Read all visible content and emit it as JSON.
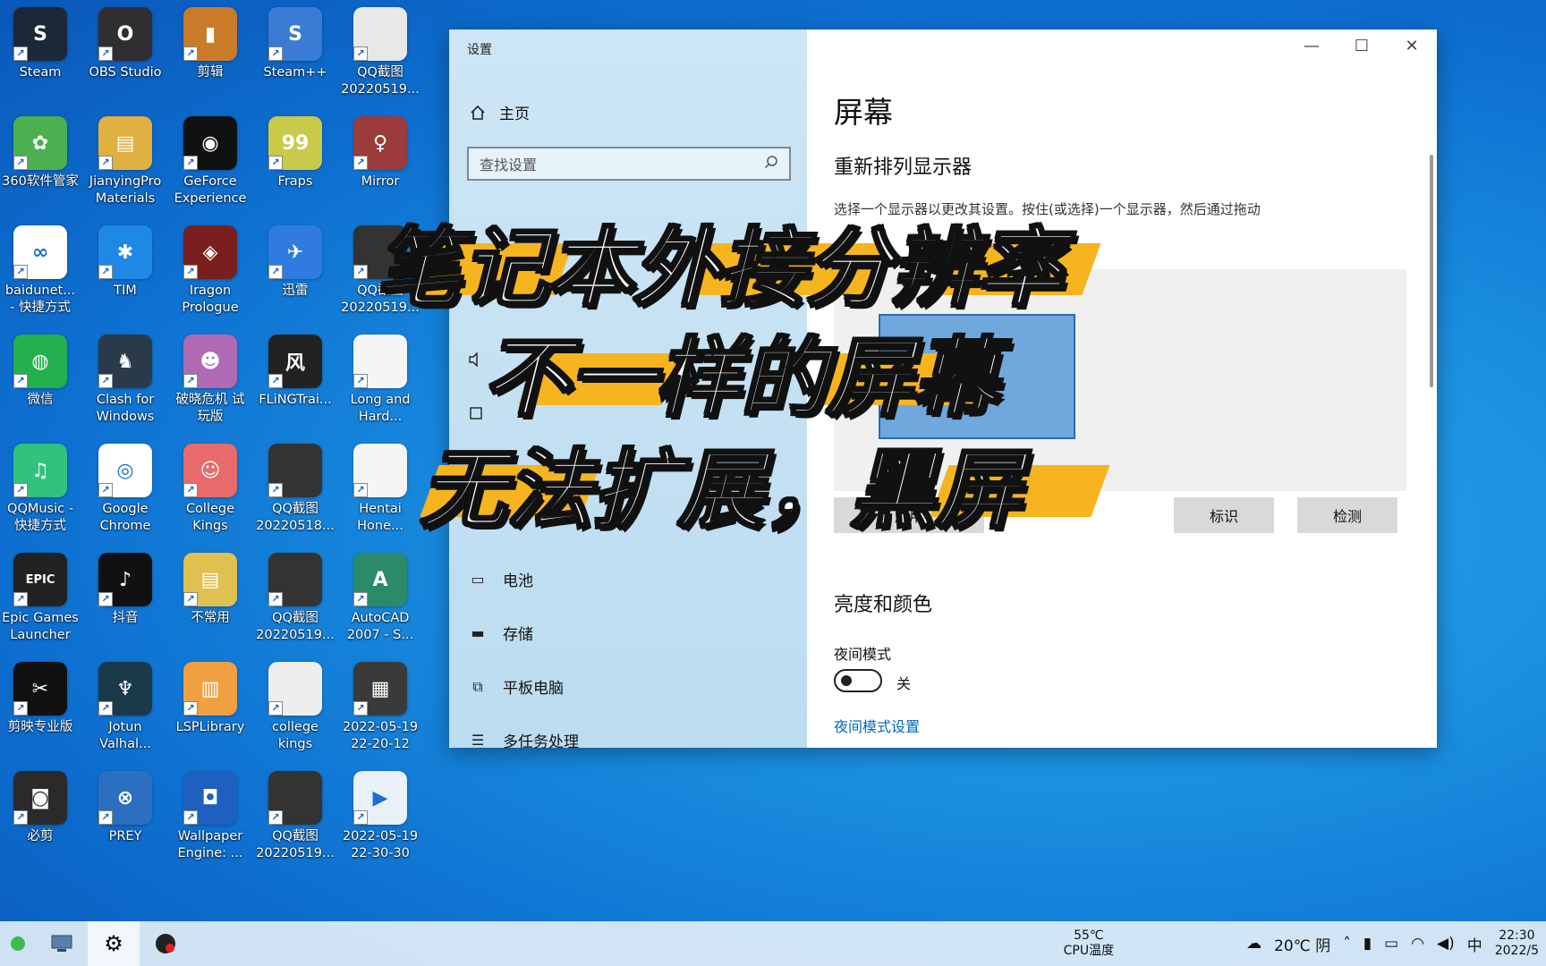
{
  "desktop": {
    "icons": [
      {
        "label": "Steam",
        "bg": "#1b2838",
        "glyph": "S"
      },
      {
        "label": "OBS Studio",
        "bg": "#302e31",
        "glyph": "O"
      },
      {
        "label": "剪辑",
        "bg": "#c97b2a",
        "glyph": "▮"
      },
      {
        "label": "Steam++",
        "bg": "#3a7bd5",
        "glyph": "S"
      },
      {
        "label": "QQ截图\n20220519...",
        "bg": "#e8e8e8",
        "glyph": ""
      },
      {
        "label": "360软件管家",
        "bg": "#4caf50",
        "glyph": "✿"
      },
      {
        "label": "JianyingPro\nMaterials",
        "bg": "#e0b040",
        "glyph": "▤"
      },
      {
        "label": "GeForce\nExperience",
        "bg": "#111111",
        "glyph": "◉"
      },
      {
        "label": "Fraps",
        "bg": "#c9c94a",
        "glyph": "99"
      },
      {
        "label": "Mirror",
        "bg": "#9b3b3b",
        "glyph": "♀"
      },
      {
        "label": "baidunet...\n- 快捷方式",
        "bg": "#ffffff",
        "glyph": "∞"
      },
      {
        "label": "TIM",
        "bg": "#1e88e5",
        "glyph": "✱"
      },
      {
        "label": "Iragon\nPrologue",
        "bg": "#7a1f1f",
        "glyph": "◈"
      },
      {
        "label": "迅雷",
        "bg": "#2f7be0",
        "glyph": "✈"
      },
      {
        "label": "QQ截图\n20220519...",
        "bg": "#333333",
        "glyph": ""
      },
      {
        "label": "微信",
        "bg": "#22b14c",
        "glyph": "◍"
      },
      {
        "label": "Clash for\nWindows",
        "bg": "#2a3a4a",
        "glyph": "♞"
      },
      {
        "label": "破晓危机 试\n玩版",
        "bg": "#b06ab3",
        "glyph": "☻"
      },
      {
        "label": "FLiNGTrai...",
        "bg": "#222222",
        "glyph": "风"
      },
      {
        "label": "Long and\nHard... ",
        "bg": "#f5f5f5",
        "glyph": ""
      },
      {
        "label": "QQMusic -\n快捷方式",
        "bg": "#31c27c",
        "glyph": "♫"
      },
      {
        "label": "Google\nChrome",
        "bg": "#ffffff",
        "glyph": "◎"
      },
      {
        "label": "College\nKings",
        "bg": "#e86a6a",
        "glyph": "☺"
      },
      {
        "label": "QQ截图\n20220518...",
        "bg": "#333333",
        "glyph": ""
      },
      {
        "label": "Hentai\nHone...",
        "bg": "#f5f5f5",
        "glyph": ""
      },
      {
        "label": "Epic Games\nLauncher",
        "bg": "#222222",
        "glyph": "EPIC"
      },
      {
        "label": "抖音",
        "bg": "#111111",
        "glyph": "♪"
      },
      {
        "label": "不常用",
        "bg": "#e0c050",
        "glyph": "▤"
      },
      {
        "label": "QQ截图\n20220519...",
        "bg": "#333333",
        "glyph": ""
      },
      {
        "label": "AutoCAD\n2007 - S...",
        "bg": "#2a8a6a",
        "glyph": "A"
      },
      {
        "label": "剪映专业版",
        "bg": "#111111",
        "glyph": "✂"
      },
      {
        "label": "Jotun\nValhal...",
        "bg": "#1a3a4a",
        "glyph": "♆"
      },
      {
        "label": "LSPLibrary",
        "bg": "#f0a040",
        "glyph": "▥"
      },
      {
        "label": "college\nkings",
        "bg": "#eeeeee",
        "glyph": ""
      },
      {
        "label": "2022-05-19\n22-20-12",
        "bg": "#3a3a3a",
        "glyph": "▦"
      },
      {
        "label": "必剪",
        "bg": "#2a2a2a",
        "glyph": "◙"
      },
      {
        "label": "PREY",
        "bg": "#2b6fc0",
        "glyph": "⊗"
      },
      {
        "label": "Wallpaper\nEngine: ...",
        "bg": "#1e5fc0",
        "glyph": "◘"
      },
      {
        "label": "QQ截图\n20220519...",
        "bg": "#333333",
        "glyph": ""
      },
      {
        "label": "2022-05-19\n22-30-30",
        "bg": "#e8f0f8",
        "glyph": "▶"
      }
    ]
  },
  "settings": {
    "app_title": "设置",
    "home_label": "主页",
    "search_placeholder": "查找设置",
    "nav": [
      {
        "label": "电池",
        "icon": "battery-icon",
        "glyph": "▭"
      },
      {
        "label": "存储",
        "icon": "storage-icon",
        "glyph": "▬"
      },
      {
        "label": "平板电脑",
        "icon": "tablet-icon",
        "glyph": "⧉"
      },
      {
        "label": "多任务处理",
        "icon": "multitask-icon",
        "glyph": "☰"
      }
    ],
    "page_title": "屏幕",
    "section_rearrange": "重新排列显示器",
    "description": "选择一个显示器以更改其设置。按住(或选择)一个显示器，然后通过拖动",
    "btn_apply": "应用",
    "btn_identify": "标识",
    "btn_detect": "检测",
    "section_brightness": "亮度和颜色",
    "night_mode_label": "夜间模式",
    "night_mode_state": "关",
    "night_mode_link": "夜间模式设置"
  },
  "caption": {
    "line1": "笔记本外接分辨率",
    "line2": "不一样的屏幕",
    "line3": "无法扩展，黑屏",
    "highlight_color": "#f6b41f"
  },
  "taskbar": {
    "cpu_temp": "55℃",
    "cpu_label": "CPU温度",
    "weather": "20℃ 阴",
    "ime": "中",
    "time": "22:30",
    "date": "2022/5"
  }
}
